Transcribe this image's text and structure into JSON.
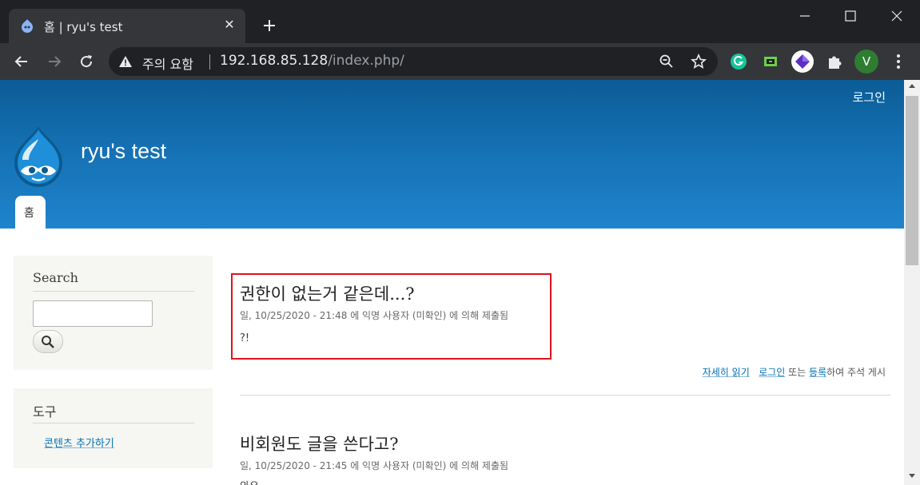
{
  "browser": {
    "tab_title": "홈 | ryu's test",
    "security_label": "주의 요함",
    "url_host": "192.168.85.128",
    "url_path": "/index.php/",
    "profile_initial": "V",
    "icons": [
      "back-icon",
      "forward-icon",
      "reload-icon",
      "warning-icon",
      "zoom-icon",
      "star-icon",
      "grammarly-icon",
      "extension-icon",
      "puzzle-icon",
      "menu-icon"
    ]
  },
  "header": {
    "login_label": "로그인",
    "site_name": "ryu's test",
    "home_tab_label": "홈"
  },
  "sidebar": {
    "search_title": "Search",
    "search_value": "",
    "tools_title": "도구",
    "tools_link": "콘텐츠 추가하기"
  },
  "nodes": [
    {
      "title": "권한이 없는거 같은데...?",
      "meta": "일, 10/25/2020 - 21:48 에 익명 사용자 (미확인) 에 의해 제출됨",
      "body": "?!"
    },
    {
      "title": "비회원도 글을 쓴다고?",
      "meta": "일, 10/25/2020 - 21:45 에 익명 사용자 (미확인) 에 의해 제출됨",
      "body": "와우"
    }
  ],
  "node_links": {
    "read_more": "자세히 읽기",
    "login": "로그인",
    "or": " 또는 ",
    "register": "등록",
    "suffix": "하여 주석 게시"
  },
  "colors": {
    "header_top": "#0b5c96",
    "header_bottom": "#1f84cc",
    "link": "#0071b3",
    "highlight": "#e0131b"
  }
}
